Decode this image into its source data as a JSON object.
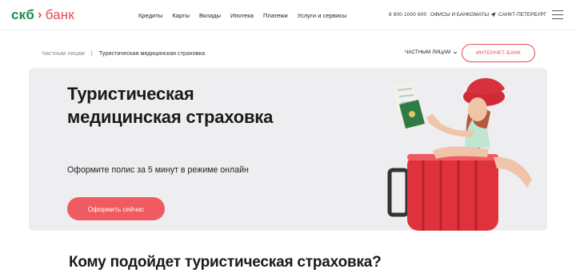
{
  "header": {
    "logo": {
      "part1": "скб",
      "part2": "банк"
    },
    "nav": [
      "Кредиты",
      "Карты",
      "Вклады",
      "Ипотека",
      "Платежи",
      "Услуги и сервисы"
    ],
    "phone": "8 800 1000 600",
    "offices": "Офисы и банкоматы",
    "city": "Санкт-Петербург",
    "menu_icon": "hamburger-icon"
  },
  "subheader": {
    "breadcrumb": [
      "Частным лицам",
      "Туристическая медицинская страховка"
    ],
    "breadcrumb_separator": "|",
    "segment": "Частным лицам",
    "internet_bank": "Интернет-банк"
  },
  "hero": {
    "title": "Туристическая медицинская страховка",
    "subtitle": "Оформите полис за 5 минут в режиме онлайн",
    "cta": "Оформить сейчас",
    "image": "woman-with-red-suitcase-illustration"
  },
  "section": {
    "title": "Кому подойдет туристическая страховка?"
  },
  "colors": {
    "brand_green": "#1f8a4c",
    "brand_red": "#e34a50",
    "cta": "#ef5b61",
    "hero_bg": "#eeedf0"
  }
}
